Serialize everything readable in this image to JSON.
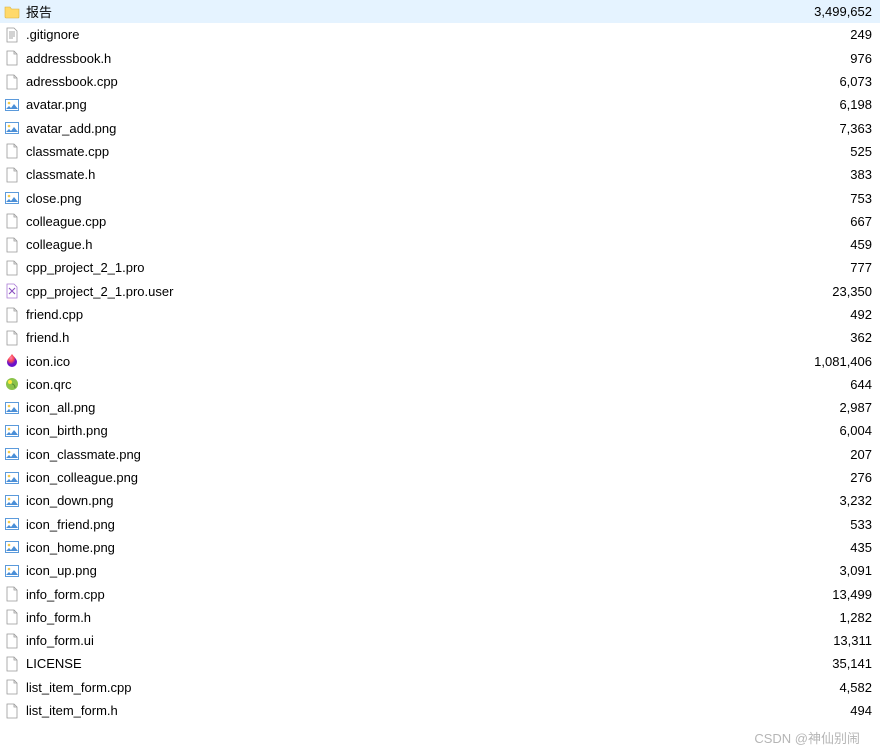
{
  "watermark": "CSDN @神仙别闹",
  "files": [
    {
      "name": "报告",
      "size": "3,499,652",
      "icon": "folder"
    },
    {
      "name": ".gitignore",
      "size": "249",
      "icon": "text"
    },
    {
      "name": "addressbook.h",
      "size": "976",
      "icon": "generic"
    },
    {
      "name": "adressbook.cpp",
      "size": "6,073",
      "icon": "generic"
    },
    {
      "name": "avatar.png",
      "size": "6,198",
      "icon": "image"
    },
    {
      "name": "avatar_add.png",
      "size": "7,363",
      "icon": "image"
    },
    {
      "name": "classmate.cpp",
      "size": "525",
      "icon": "generic"
    },
    {
      "name": "classmate.h",
      "size": "383",
      "icon": "generic"
    },
    {
      "name": "close.png",
      "size": "753",
      "icon": "image"
    },
    {
      "name": "colleague.cpp",
      "size": "667",
      "icon": "generic"
    },
    {
      "name": "colleague.h",
      "size": "459",
      "icon": "generic"
    },
    {
      "name": "cpp_project_2_1.pro",
      "size": "777",
      "icon": "generic"
    },
    {
      "name": "cpp_project_2_1.pro.user",
      "size": "23,350",
      "icon": "vs"
    },
    {
      "name": "friend.cpp",
      "size": "492",
      "icon": "generic"
    },
    {
      "name": "friend.h",
      "size": "362",
      "icon": "generic"
    },
    {
      "name": "icon.ico",
      "size": "1,081,406",
      "icon": "ico"
    },
    {
      "name": "icon.qrc",
      "size": "644",
      "icon": "qrc"
    },
    {
      "name": "icon_all.png",
      "size": "2,987",
      "icon": "image"
    },
    {
      "name": "icon_birth.png",
      "size": "6,004",
      "icon": "image"
    },
    {
      "name": "icon_classmate.png",
      "size": "207",
      "icon": "image"
    },
    {
      "name": "icon_colleague.png",
      "size": "276",
      "icon": "image"
    },
    {
      "name": "icon_down.png",
      "size": "3,232",
      "icon": "image"
    },
    {
      "name": "icon_friend.png",
      "size": "533",
      "icon": "image"
    },
    {
      "name": "icon_home.png",
      "size": "435",
      "icon": "image"
    },
    {
      "name": "icon_up.png",
      "size": "3,091",
      "icon": "image"
    },
    {
      "name": "info_form.cpp",
      "size": "13,499",
      "icon": "generic"
    },
    {
      "name": "info_form.h",
      "size": "1,282",
      "icon": "generic"
    },
    {
      "name": "info_form.ui",
      "size": "13,311",
      "icon": "generic"
    },
    {
      "name": "LICENSE",
      "size": "35,141",
      "icon": "generic"
    },
    {
      "name": "list_item_form.cpp",
      "size": "4,582",
      "icon": "generic"
    },
    {
      "name": "list_item_form.h",
      "size": "494",
      "icon": "generic"
    }
  ],
  "icons": {
    "folder": "folder-icon",
    "text": "text-file-icon",
    "generic": "generic-file-icon",
    "image": "image-file-icon",
    "vs": "vs-file-icon",
    "ico": "ico-file-icon",
    "qrc": "qrc-file-icon"
  }
}
